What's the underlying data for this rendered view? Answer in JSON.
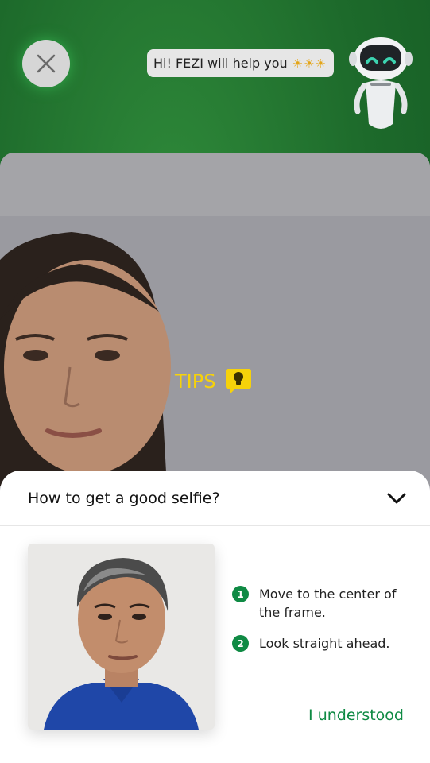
{
  "header": {
    "close_icon": "close-icon",
    "bubble_text": "Hi! FEZI will help you",
    "bubble_emoji": "☀☀☀",
    "mascot": "robot-mascot"
  },
  "camera": {
    "tips_label": "TIPS",
    "tips_icon": "lightbulb-speech-icon"
  },
  "sheet": {
    "title": "How to get a good selfie?",
    "toggle_icon": "chevron-down-icon",
    "steps": [
      {
        "num": "1",
        "text": "Move to the center of the frame."
      },
      {
        "num": "2",
        "text": "Look straight ahead."
      }
    ],
    "confirm_label": "I understood"
  },
  "colors": {
    "accent_green": "#0f8a44",
    "tips_yellow": "#f6d20a",
    "background_green": "#1d6a2b"
  }
}
